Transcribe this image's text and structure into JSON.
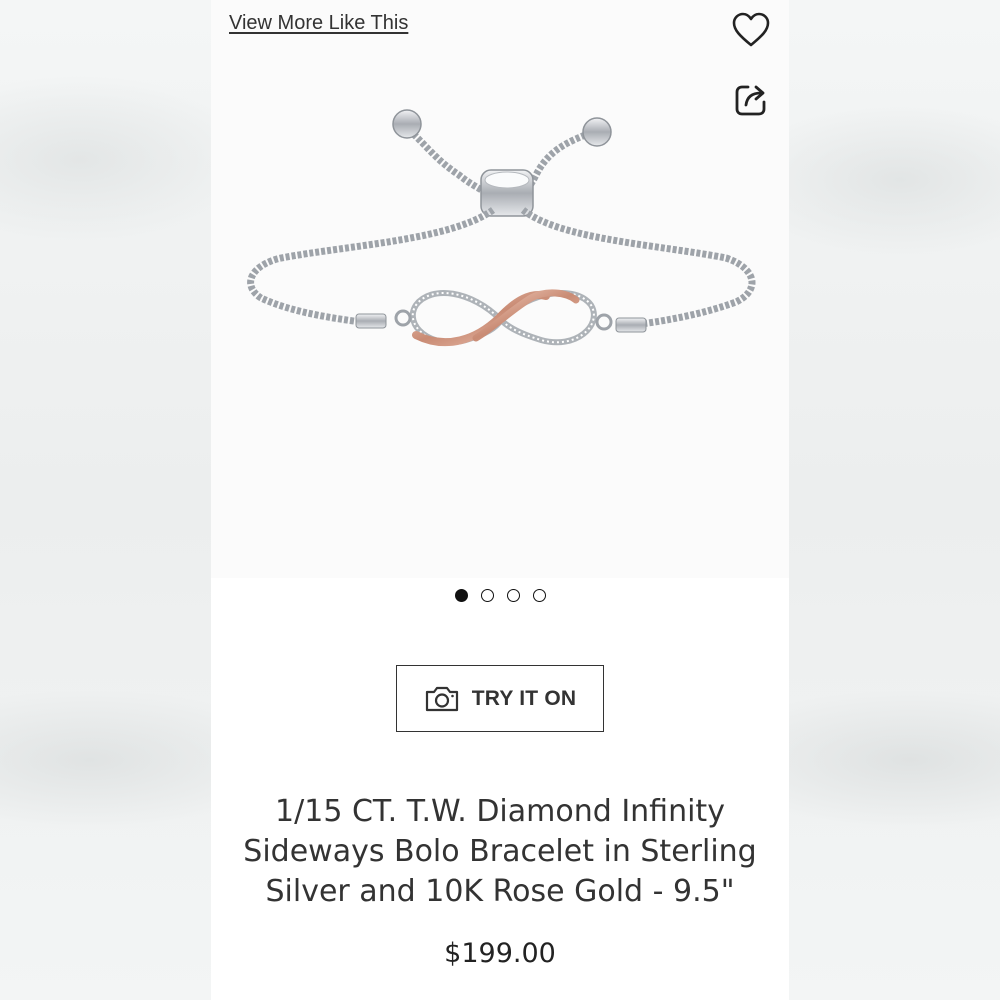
{
  "header": {
    "view_more_label": "View More Like This",
    "favorite_icon": "heart-icon",
    "share_icon": "share-icon"
  },
  "carousel": {
    "image_description_icon": "bracelet-image",
    "page_count": 4,
    "active_page": 1
  },
  "try_on": {
    "icon": "camera-icon",
    "label": "TRY IT ON"
  },
  "product": {
    "title": "1/15 CT. T.W. Diamond Infinity Sideways Bolo Bracelet in Sterling Silver and 10K Rose Gold - 9.5\"",
    "price": "$199.00"
  },
  "colors": {
    "text": "#333333",
    "silver": "#b9bdc2",
    "rose_gold": "#d9a58f"
  }
}
